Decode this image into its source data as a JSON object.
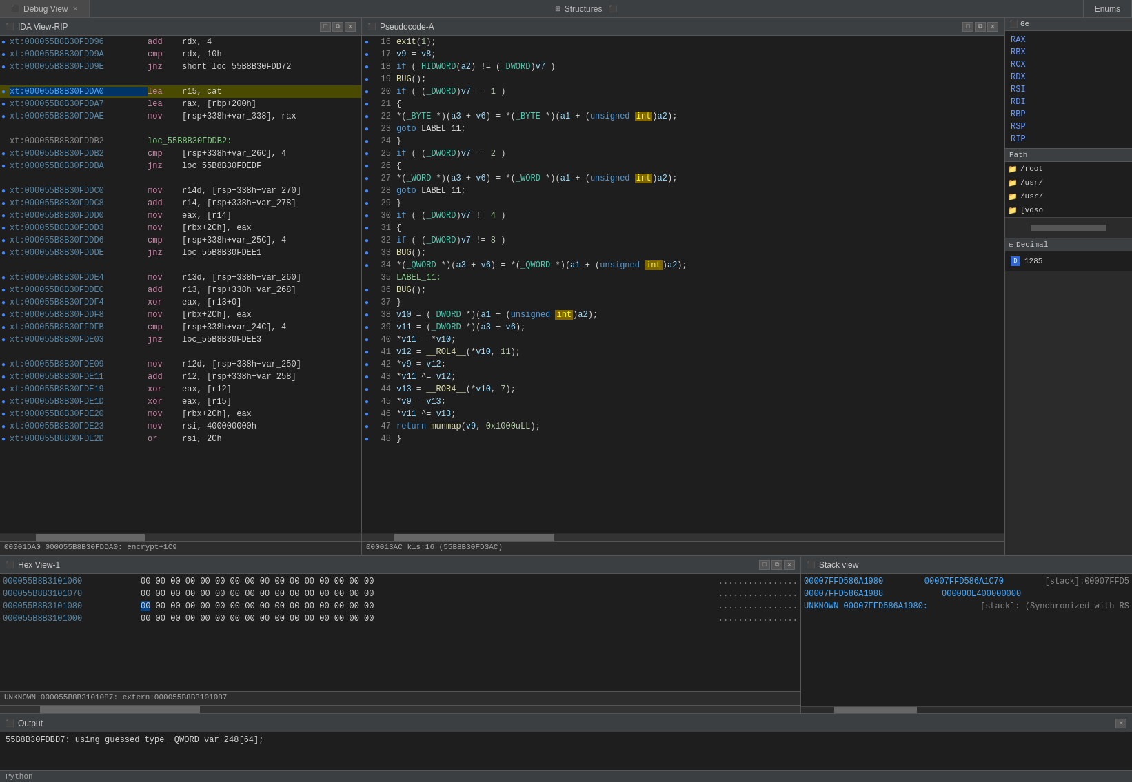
{
  "tabs": {
    "debug_view": "Debug View",
    "structures": "Structures",
    "enums": "Enums"
  },
  "ida_panel": {
    "title": "IDA View-RIP",
    "asm_lines": [
      {
        "addr": "xt:000055B8B30FDD96",
        "mnem": "add",
        "ops": "rdx, 4",
        "dot": true
      },
      {
        "addr": "xt:000055B8B30FDD9A",
        "mnem": "cmp",
        "ops": "rdx, 10h",
        "dot": true
      },
      {
        "addr": "xt:000055B8B30FDD9E",
        "mnem": "jnz",
        "ops": "short loc_55B8B30FDD72",
        "dot": true
      },
      {
        "addr": "xt:000055B8B30FDD9E",
        "mnem": "",
        "ops": "",
        "dot": false
      },
      {
        "addr": "xt:000055B8B30FDDA0",
        "mnem": "lea",
        "ops": "r15, cat",
        "dot": true,
        "highlight": true
      },
      {
        "addr": "xt:000055B8B30FDDA7",
        "mnem": "lea",
        "ops": "rax, [rbp+200h]",
        "dot": true
      },
      {
        "addr": "xt:000055B8B30FDDAE",
        "mnem": "mov",
        "ops": "[rsp+338h+var_338], rax",
        "dot": true
      },
      {
        "addr": "xt:000055B8B30FDDB2",
        "mnem": "",
        "ops": "",
        "dot": false
      },
      {
        "addr": "xt:000055B8B30FDDB2",
        "mnem": "",
        "ops": "loc_55B8B30FDDB2:",
        "dot": false,
        "label": true
      },
      {
        "addr": "xt:000055B8B30FDDB2",
        "mnem": "cmp",
        "ops": "[rsp+338h+var_26C], 4",
        "dot": true
      },
      {
        "addr": "xt:000055B8B30FDDBA",
        "mnem": "jnz",
        "ops": "loc_55B8B30FDEDF",
        "dot": true
      },
      {
        "addr": "xt:000055B8B30FDDBA",
        "mnem": "",
        "ops": "",
        "dot": false
      },
      {
        "addr": "xt:000055B8B30FDDC0",
        "mnem": "mov",
        "ops": "r14d, [rsp+338h+var_270]",
        "dot": true
      },
      {
        "addr": "xt:000055B8B30FDDC8",
        "mnem": "add",
        "ops": "r14, [rsp+338h+var_278]",
        "dot": true
      },
      {
        "addr": "xt:000055B8B30FDDD0",
        "mnem": "mov",
        "ops": "eax, [r14]",
        "dot": true
      },
      {
        "addr": "xt:000055B8B30FDDD3",
        "mnem": "mov",
        "ops": "[rbx+2Ch], eax",
        "dot": true
      },
      {
        "addr": "xt:000055B8B30FDDD6",
        "mnem": "cmp",
        "ops": "[rsp+338h+var_25C], 4",
        "dot": true
      },
      {
        "addr": "xt:000055B8B30FDDDE",
        "mnem": "jnz",
        "ops": "loc_55B8B30FDEE1",
        "dot": true
      },
      {
        "addr": "xt:000055B8B30FDDDE",
        "mnem": "",
        "ops": "",
        "dot": false
      },
      {
        "addr": "xt:000055B8B30FDDE4",
        "mnem": "mov",
        "ops": "r13d, [rsp+338h+var_260]",
        "dot": true
      },
      {
        "addr": "xt:000055B8B30FDDEC",
        "mnem": "add",
        "ops": "r13, [rsp+338h+var_268]",
        "dot": true
      },
      {
        "addr": "xt:000055B8B30FDDF4",
        "mnem": "xor",
        "ops": "eax, [r13+0]",
        "dot": true
      },
      {
        "addr": "xt:000055B8B30FDDF8",
        "mnem": "mov",
        "ops": "[rbx+2Ch], eax",
        "dot": true
      },
      {
        "addr": "xt:000055B8B30FFDFB",
        "mnem": "cmp",
        "ops": "[rsp+338h+var_24C], 4",
        "dot": true
      },
      {
        "addr": "xt:000055B8B30FDE03",
        "mnem": "jnz",
        "ops": "loc_55B8B30FDEE3",
        "dot": true
      },
      {
        "addr": "xt:000055B8B30FDE03",
        "mnem": "",
        "ops": "",
        "dot": false
      },
      {
        "addr": "xt:000055B8B30FDE09",
        "mnem": "mov",
        "ops": "r12d, [rsp+338h+var_250]",
        "dot": true
      },
      {
        "addr": "xt:000055B8B30FDE11",
        "mnem": "add",
        "ops": "r12, [rsp+338h+var_258]",
        "dot": true
      },
      {
        "addr": "xt:000055B8B30FDE19",
        "mnem": "xor",
        "ops": "eax, [r12]",
        "dot": true
      },
      {
        "addr": "xt:000055B8B30FDE1D",
        "mnem": "xor",
        "ops": "eax, [r15]",
        "dot": true
      },
      {
        "addr": "xt:000055B8B30FDE20",
        "mnem": "mov",
        "ops": "[rbx+2Ch], eax",
        "dot": true
      },
      {
        "addr": "xt:000055B8B30FDE23",
        "mnem": "mov",
        "ops": "rsi, 400000000h",
        "dot": true
      },
      {
        "addr": "xt:000055B8B30FDE2D",
        "mnem": "or",
        "ops": "rsi, 2Ch",
        "dot": true
      }
    ],
    "status": "00001DA0 000055B8B30FDDA0: encrypt+1C9"
  },
  "pseudo_panel": {
    "title": "Pseudocode-A",
    "lines": [
      {
        "num": 16,
        "code": "exit(1);",
        "dot": true
      },
      {
        "num": 17,
        "code": "v9 = v8;",
        "dot": true
      },
      {
        "num": 18,
        "code": "if ( HIDWORD(a2) != (_DWORD)v7 )",
        "dot": true
      },
      {
        "num": 19,
        "code": "BUG();",
        "dot": true
      },
      {
        "num": 20,
        "code": "if ( (_DWORD)v7 == 1 )",
        "dot": true
      },
      {
        "num": 21,
        "code": "{",
        "dot": true
      },
      {
        "num": 22,
        "code": "*(_BYTE *)(a3 + v6) = *(_BYTE *)(a1 + (unsigned int)a2);",
        "dot": true,
        "has_int": true
      },
      {
        "num": 23,
        "code": "goto LABEL_11;",
        "dot": true
      },
      {
        "num": 24,
        "code": "}",
        "dot": true
      },
      {
        "num": 25,
        "code": "if ( (_DWORD)v7 == 2 )",
        "dot": true
      },
      {
        "num": 26,
        "code": "{",
        "dot": true
      },
      {
        "num": 27,
        "code": "*(_WORD *)(a3 + v6) = *(_WORD *)(a1 + (unsigned int)a2);",
        "dot": true,
        "has_int": true
      },
      {
        "num": 28,
        "code": "goto LABEL_11;",
        "dot": true
      },
      {
        "num": 29,
        "code": "}",
        "dot": true
      },
      {
        "num": 30,
        "code": "if ( (_DWORD)v7 != 4 )",
        "dot": true
      },
      {
        "num": 31,
        "code": "{",
        "dot": true
      },
      {
        "num": 32,
        "code": "if ( (_DWORD)v7 != 8 )",
        "dot": true
      },
      {
        "num": 33,
        "code": "BUG();",
        "dot": true
      },
      {
        "num": 34,
        "code": "*(_QWORD *)(a3 + v6) = *(_QWORD *)(a1 + (unsigned int)a2);",
        "dot": true,
        "has_int": true
      },
      {
        "num": 35,
        "code": "LABEL_11:",
        "dot": false
      },
      {
        "num": 36,
        "code": "BUG();",
        "dot": true
      },
      {
        "num": 37,
        "code": "}",
        "dot": true
      },
      {
        "num": 38,
        "code": "v10 = (_DWORD *)(a1 + (unsigned int)a2);",
        "dot": true,
        "has_int2": true
      },
      {
        "num": 39,
        "code": "v11 = (_DWORD *)(a3 + v6);",
        "dot": true
      },
      {
        "num": 40,
        "code": "*v11 = *v10;",
        "dot": true
      },
      {
        "num": 41,
        "code": "v12 = __ROL4__(*v10, 11);",
        "dot": true
      },
      {
        "num": 42,
        "code": "*v9 = v12;",
        "dot": true
      },
      {
        "num": 43,
        "code": "*v11 ^= v12;",
        "dot": true
      },
      {
        "num": 44,
        "code": "v13 = __ROR4__(*v10, 7);",
        "dot": true
      },
      {
        "num": 45,
        "code": "*v9 = v13;",
        "dot": true
      },
      {
        "num": 46,
        "code": "*v11 ^= v13;",
        "dot": true
      },
      {
        "num": 47,
        "code": "return munmap(v9, 0x1000uLL);",
        "dot": true
      },
      {
        "num": 48,
        "code": "}",
        "dot": true
      }
    ],
    "status": "000013AC kls:16  (55B8B30FD3AC)"
  },
  "registers": {
    "title": "Ge",
    "items": [
      {
        "name": "RAX",
        "val": ""
      },
      {
        "name": "RBX",
        "val": ""
      },
      {
        "name": "RCX",
        "val": ""
      },
      {
        "name": "RDX",
        "val": ""
      },
      {
        "name": "RSI",
        "val": ""
      },
      {
        "name": "RDI",
        "val": ""
      },
      {
        "name": "RBP",
        "val": ""
      },
      {
        "name": "RSP",
        "val": ""
      },
      {
        "name": "RIP",
        "val": ""
      }
    ]
  },
  "path_panel": {
    "title": "Path",
    "items": [
      {
        "icon": "folder",
        "text": "/root"
      },
      {
        "icon": "folder",
        "text": "/usr/"
      },
      {
        "icon": "folder",
        "text": "/usr/"
      },
      {
        "icon": "folder",
        "text": "[vdso"
      }
    ]
  },
  "decimal_panel": {
    "title": "Decimal",
    "items": [
      {
        "icon": "D",
        "text": "1285"
      }
    ]
  },
  "hex_panel": {
    "title": "Hex View-1",
    "lines": [
      {
        "addr": "000055B8B3101060",
        "bytes": "00 00 00 00 00 00 00 00  00 00 00 00 00 00 00 00",
        "ascii": "................"
      },
      {
        "addr": "000055B8B3101070",
        "bytes": "00 00 00 00 00 00 00 00  00 00 00 00 00 00 00 00",
        "ascii": "................"
      },
      {
        "addr": "000055B8B3101080",
        "bytes": "00 00 00 00 00 00 00 00  00 00 00 00 00 00 00 00",
        "ascii": "................",
        "has_sel": true
      },
      {
        "addr": "000055B8B3101000",
        "bytes": "00 00 00 00 00 00 00 00  00 00 00 00 00 00 00 00",
        "ascii": "................"
      }
    ],
    "status_line": "UNKNOWN 000055B8B3101087: extern:000055B8B3101087"
  },
  "stack_panel": {
    "title": "Stack view",
    "lines": [
      {
        "addr1": "00007FFD586A1980",
        "addr2": "00007FFD586A1C70",
        "comment": "[stack]:00007FFD5"
      },
      {
        "addr1": "00007FFD586A1988",
        "addr2": "000000E400000000",
        "comment": ""
      },
      {
        "addr1": "UNKNOWN 00007FFD586A1980:",
        "addr2": "",
        "comment": "[stack]: (Synchronized with RS"
      }
    ]
  },
  "output_panel": {
    "title": "Output",
    "text": "55B8B30FDBD7: using guessed type _QWORD var_248[64];",
    "python_label": "Python"
  }
}
